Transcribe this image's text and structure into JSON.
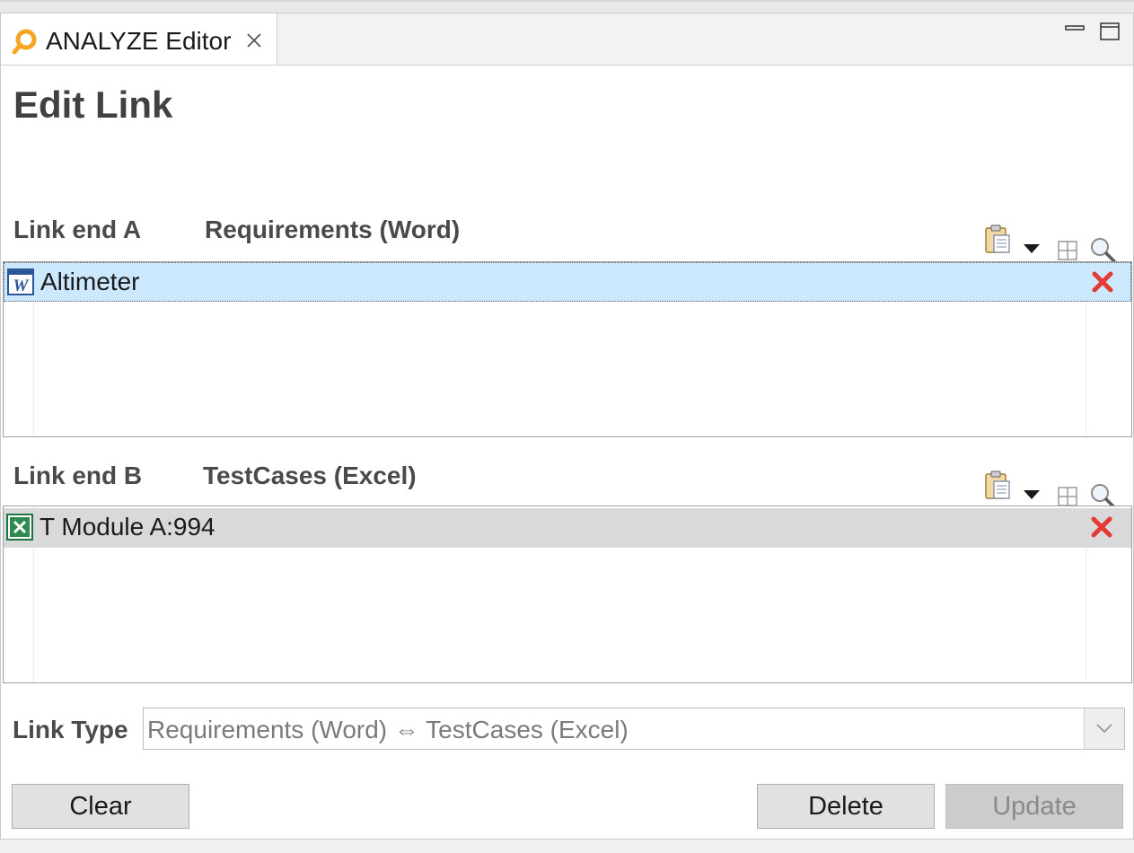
{
  "tab": {
    "title": "ANALYZE Editor",
    "icon": "analyze-icon"
  },
  "page": {
    "title": "Edit Link"
  },
  "link_end_a": {
    "label": "Link end A",
    "type": "Requirements (Word)",
    "items": [
      {
        "label": "Altimeter",
        "icon": "word-icon",
        "selected": true
      }
    ]
  },
  "link_end_b": {
    "label": "Link end B",
    "type": "TestCases (Excel)",
    "items": [
      {
        "label": "T Module A:994",
        "icon": "excel-icon",
        "selected": false
      }
    ]
  },
  "link_type": {
    "label": "Link Type",
    "value": "Requirements (Word) ⇔ TestCases (Excel)"
  },
  "buttons": {
    "clear": "Clear",
    "delete": "Delete",
    "update": "Update"
  },
  "colors": {
    "selection": "#cce8ff",
    "accent": "#f5a623",
    "delete": "#e53935"
  }
}
